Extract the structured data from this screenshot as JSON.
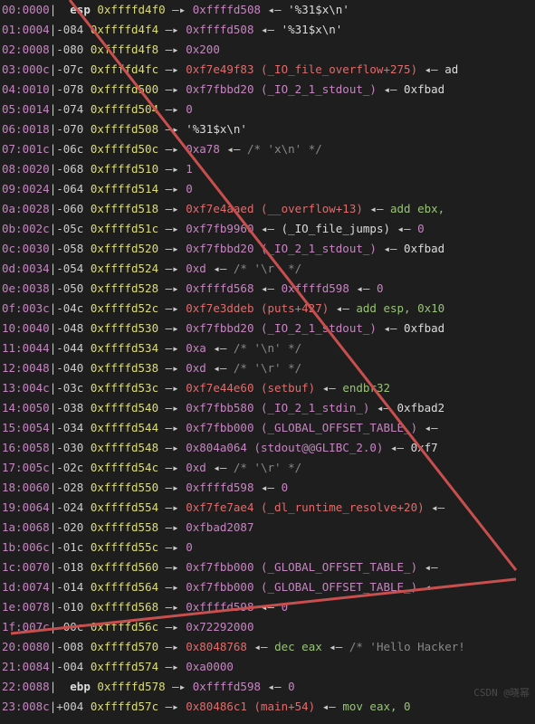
{
  "rows": [
    {
      "i": "00:0000",
      "reg": "esp",
      "o": "",
      "a": "0xffffd4f0",
      "p": [
        {
          "t": "hex",
          "v": "0xffffd508"
        },
        {
          "t": "wht",
          "v": "'%31$x\\n'"
        }
      ]
    },
    {
      "i": "01:0004",
      "reg": "",
      "o": "-084",
      "a": "0xffffd4f4",
      "p": [
        {
          "t": "hex",
          "v": "0xffffd508"
        },
        {
          "t": "wht",
          "v": "'%31$x\\n'"
        }
      ]
    },
    {
      "i": "02:0008",
      "reg": "",
      "o": "-080",
      "a": "0xffffd4f8",
      "p": [
        {
          "t": "hex",
          "v": "0x200"
        }
      ]
    },
    {
      "i": "03:000c",
      "reg": "",
      "o": "-07c",
      "a": "0xffffd4fc",
      "p": [
        {
          "t": "red",
          "v": "0xf7e49f83 (_IO_file_overflow+275)"
        },
        {
          "t": "wht",
          "v": "ad"
        }
      ]
    },
    {
      "i": "04:0010",
      "reg": "",
      "o": "-078",
      "a": "0xffffd500",
      "p": [
        {
          "t": "pur",
          "v": "0xf7fbbd20 (_IO_2_1_stdout_)"
        },
        {
          "t": "wht",
          "v": "0xfbad"
        }
      ]
    },
    {
      "i": "05:0014",
      "reg": "",
      "o": "-074",
      "a": "0xffffd504",
      "p": [
        {
          "t": "hex",
          "v": "0"
        }
      ]
    },
    {
      "i": "06:0018",
      "reg": "",
      "o": "-070",
      "a": "0xffffd508",
      "p": [
        {
          "t": "wht",
          "v": "'%31$x\\n'"
        }
      ]
    },
    {
      "i": "07:001c",
      "reg": "",
      "o": "-06c",
      "a": "0xffffd50c",
      "p": [
        {
          "t": "hex",
          "v": "0xa78"
        },
        {
          "t": "com",
          "v": "/* 'x\\n' */"
        }
      ]
    },
    {
      "i": "08:0020",
      "reg": "",
      "o": "-068",
      "a": "0xffffd510",
      "p": [
        {
          "t": "hex",
          "v": "1"
        }
      ]
    },
    {
      "i": "09:0024",
      "reg": "",
      "o": "-064",
      "a": "0xffffd514",
      "p": [
        {
          "t": "hex",
          "v": "0"
        }
      ]
    },
    {
      "i": "0a:0028",
      "reg": "",
      "o": "-060",
      "a": "0xffffd518",
      "p": [
        {
          "t": "red",
          "v": "0xf7e4aaed (__overflow+13)"
        },
        {
          "t": "grn",
          "v": "add ebx,"
        }
      ]
    },
    {
      "i": "0b:002c",
      "reg": "",
      "o": "-05c",
      "a": "0xffffd51c",
      "p": [
        {
          "t": "hex",
          "v": "0xf7fb9960"
        },
        {
          "t": "wht",
          "v": "(_IO_file_jumps)"
        },
        {
          "t": "hex",
          "v": "0"
        }
      ]
    },
    {
      "i": "0c:0030",
      "reg": "",
      "o": "-058",
      "a": "0xffffd520",
      "p": [
        {
          "t": "pur",
          "v": "0xf7fbbd20 (_IO_2_1_stdout_)"
        },
        {
          "t": "wht",
          "v": "0xfbad"
        }
      ]
    },
    {
      "i": "0d:0034",
      "reg": "",
      "o": "-054",
      "a": "0xffffd524",
      "p": [
        {
          "t": "hex",
          "v": "0xd"
        },
        {
          "t": "com",
          "v": "/* '\\r' */"
        }
      ]
    },
    {
      "i": "0e:0038",
      "reg": "",
      "o": "-050",
      "a": "0xffffd528",
      "p": [
        {
          "t": "hex",
          "v": "0xffffd568"
        },
        {
          "t": "hex",
          "v": "0xffffd598"
        },
        {
          "t": "hex",
          "v": "0"
        }
      ]
    },
    {
      "i": "0f:003c",
      "reg": "",
      "o": "-04c",
      "a": "0xffffd52c",
      "p": [
        {
          "t": "red",
          "v": "0xf7e3ddeb (puts+427)"
        },
        {
          "t": "grn",
          "v": "add esp, 0x10"
        }
      ]
    },
    {
      "i": "10:0040",
      "reg": "",
      "o": "-048",
      "a": "0xffffd530",
      "p": [
        {
          "t": "pur",
          "v": "0xf7fbbd20 (_IO_2_1_stdout_)"
        },
        {
          "t": "wht",
          "v": "0xfbad"
        }
      ]
    },
    {
      "i": "11:0044",
      "reg": "",
      "o": "-044",
      "a": "0xffffd534",
      "p": [
        {
          "t": "hex",
          "v": "0xa"
        },
        {
          "t": "com",
          "v": "/* '\\n' */"
        }
      ]
    },
    {
      "i": "12:0048",
      "reg": "",
      "o": "-040",
      "a": "0xffffd538",
      "p": [
        {
          "t": "hex",
          "v": "0xd"
        },
        {
          "t": "com",
          "v": "/* '\\r' */"
        }
      ]
    },
    {
      "i": "13:004c",
      "reg": "",
      "o": "-03c",
      "a": "0xffffd53c",
      "p": [
        {
          "t": "red",
          "v": "0xf7e44e60 (setbuf)"
        },
        {
          "t": "grn",
          "v": "endbr32"
        }
      ]
    },
    {
      "i": "14:0050",
      "reg": "",
      "o": "-038",
      "a": "0xffffd540",
      "p": [
        {
          "t": "pur",
          "v": "0xf7fbb580 (_IO_2_1_stdin_)"
        },
        {
          "t": "wht",
          "v": "0xfbad2"
        }
      ]
    },
    {
      "i": "15:0054",
      "reg": "",
      "o": "-034",
      "a": "0xffffd544",
      "p": [
        {
          "t": "pur",
          "v": "0xf7fbb000 (_GLOBAL_OFFSET_TABLE_)"
        },
        {
          "t": "wht",
          "v": ""
        }
      ]
    },
    {
      "i": "16:0058",
      "reg": "",
      "o": "-030",
      "a": "0xffffd548",
      "p": [
        {
          "t": "pur",
          "v": "0x804a064 (stdout@@GLIBC_2.0)"
        },
        {
          "t": "wht",
          "v": "0xf7"
        }
      ]
    },
    {
      "i": "17:005c",
      "reg": "",
      "o": "-02c",
      "a": "0xffffd54c",
      "p": [
        {
          "t": "hex",
          "v": "0xd"
        },
        {
          "t": "com",
          "v": "/* '\\r' */"
        }
      ]
    },
    {
      "i": "18:0060",
      "reg": "",
      "o": "-028",
      "a": "0xffffd550",
      "p": [
        {
          "t": "hex",
          "v": "0xffffd598"
        },
        {
          "t": "hex",
          "v": "0"
        }
      ]
    },
    {
      "i": "19:0064",
      "reg": "",
      "o": "-024",
      "a": "0xffffd554",
      "p": [
        {
          "t": "red",
          "v": "0xf7fe7ae4 (_dl_runtime_resolve+20)"
        },
        {
          "t": "wht",
          "v": ""
        }
      ]
    },
    {
      "i": "1a:0068",
      "reg": "",
      "o": "-020",
      "a": "0xffffd558",
      "p": [
        {
          "t": "hex",
          "v": "0xfbad2087"
        }
      ]
    },
    {
      "i": "1b:006c",
      "reg": "",
      "o": "-01c",
      "a": "0xffffd55c",
      "p": [
        {
          "t": "hex",
          "v": "0"
        }
      ]
    },
    {
      "i": "1c:0070",
      "reg": "",
      "o": "-018",
      "a": "0xffffd560",
      "p": [
        {
          "t": "pur",
          "v": "0xf7fbb000 (_GLOBAL_OFFSET_TABLE_)"
        },
        {
          "t": "wht",
          "v": ""
        }
      ]
    },
    {
      "i": "1d:0074",
      "reg": "",
      "o": "-014",
      "a": "0xffffd564",
      "p": [
        {
          "t": "pur",
          "v": "0xf7fbb000 (_GLOBAL_OFFSET_TABLE_)"
        },
        {
          "t": "wht",
          "v": ""
        }
      ]
    },
    {
      "i": "1e:0078",
      "reg": "",
      "o": "-010",
      "a": "0xffffd568",
      "p": [
        {
          "t": "hex",
          "v": "0xffffd598"
        },
        {
          "t": "hex",
          "v": "0"
        }
      ]
    },
    {
      "i": "1f:007c",
      "reg": "",
      "o": "-00c",
      "a": "0xffffd56c",
      "p": [
        {
          "t": "hex",
          "v": "0x72292000"
        }
      ]
    },
    {
      "i": "20:0080",
      "reg": "",
      "o": "-008",
      "a": "0xffffd570",
      "p": [
        {
          "t": "red",
          "v": "0x8048768"
        },
        {
          "t": "grn",
          "v": "dec eax"
        },
        {
          "t": "com",
          "v": "/* 'Hello Hacker!"
        }
      ]
    },
    {
      "i": "21:0084",
      "reg": "",
      "o": "-004",
      "a": "0xffffd574",
      "p": [
        {
          "t": "hex",
          "v": "0xa0000"
        }
      ]
    },
    {
      "i": "22:0088",
      "reg": "ebp",
      "o": "",
      "a": "0xffffd578",
      "p": [
        {
          "t": "hex",
          "v": "0xffffd598"
        },
        {
          "t": "hex",
          "v": "0"
        }
      ]
    },
    {
      "i": "23:008c",
      "reg": "",
      "o": "+004",
      "a": "0xffffd57c",
      "p": [
        {
          "t": "red",
          "v": "0x80486c1 (main+54)"
        },
        {
          "t": "grn",
          "v": "mov eax, 0"
        }
      ]
    }
  ],
  "watermark": "CSDN @晓幂"
}
